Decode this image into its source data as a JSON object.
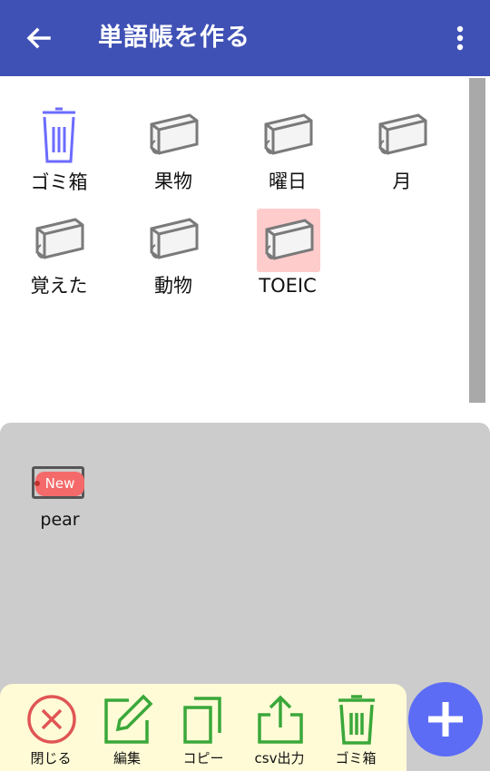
{
  "appbar": {
    "title": "単語帳を作る",
    "back_icon": "arrow-left-icon",
    "menu_icon": "more-vertical-icon",
    "color": "#3f51b5"
  },
  "folders": [
    {
      "label": "ゴミ箱",
      "icon": "trash-icon"
    },
    {
      "label": "果物",
      "icon": "card-box-icon"
    },
    {
      "label": "曜日",
      "icon": "card-box-icon"
    },
    {
      "label": "月",
      "icon": "card-box-icon"
    },
    {
      "label": "覚えた",
      "icon": "card-box-icon"
    },
    {
      "label": "動物",
      "icon": "card-box-icon"
    },
    {
      "label": "TOEIC",
      "icon": "card-box-icon",
      "selected": true
    }
  ],
  "cards": [
    {
      "label": "pear",
      "badge": "New"
    }
  ],
  "toolbar": {
    "close": "閉じる",
    "edit": "編集",
    "copy": "コピー",
    "csv": "csv出力",
    "trash": "ゴミ箱"
  },
  "fab": {
    "icon": "plus-icon",
    "color": "#5c6cf5"
  },
  "colors": {
    "toolbar_icon_green": "#3aa83a",
    "close_red": "#e05555",
    "badge": "#f46a6a",
    "selected_folder": "#ffcccc"
  }
}
